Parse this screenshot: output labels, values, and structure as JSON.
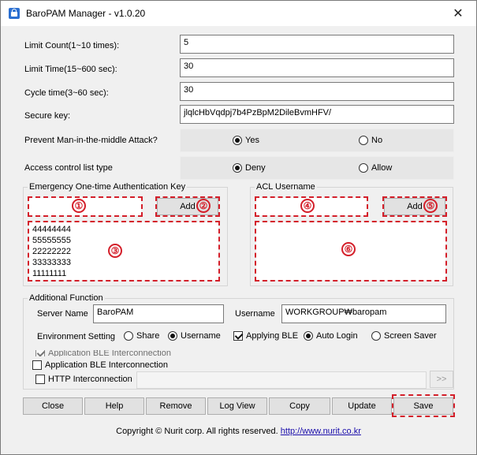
{
  "window": {
    "title": "BaroPAM Manager - v1.0.20",
    "close_glyph": "✕"
  },
  "fields": {
    "limit_count": {
      "label": "Limit Count(1~10 times):",
      "value": "5"
    },
    "limit_time": {
      "label": "Limit Time(15~600 sec):",
      "value": "30"
    },
    "cycle_time": {
      "label": "Cycle time(3~60 sec):",
      "value": "30"
    },
    "secure_key": {
      "label": "Secure key:",
      "value": "jlqlcHbVqdpj7b4PzBpM2DileBvmHFV/"
    }
  },
  "mitm": {
    "label": "Prevent Man-in-the-middle Attack?",
    "yes": "Yes",
    "no": "No",
    "selected": "Yes"
  },
  "acl_type": {
    "label": "Access control list type",
    "deny": "Deny",
    "allow": "Allow",
    "selected": "Deny"
  },
  "emergency": {
    "title": "Emergency One-time Authentication Key",
    "input_value": "",
    "add_label": "Add",
    "keys": [
      "44444444",
      "55555555",
      "22222222",
      "33333333",
      "11111111"
    ]
  },
  "acl": {
    "title": "ACL Username",
    "input_value": "",
    "add_label": "Add",
    "users": []
  },
  "markers": [
    "①",
    "②",
    "③",
    "④",
    "⑤",
    "⑥"
  ],
  "additional": {
    "title": "Additional Function",
    "server_name_label": "Server Name",
    "server_name_value": "BaroPAM",
    "username_label": "Username",
    "username_value": "WORKGROUP₩baropam",
    "env_label": "Environment Setting",
    "share": "Share",
    "username_opt": "Username",
    "env_selected": "Username",
    "applying_ble": "Applying BLE",
    "auto_login": "Auto Login",
    "screen_saver": "Screen Saver",
    "login_selected": "Auto Login",
    "ghost_text": "Application BLE Interconnection",
    "app_ble": "Application BLE Interconnection",
    "http": "HTTP Interconnection",
    "http_value": "",
    "go_label": ">>"
  },
  "buttons": {
    "close": "Close",
    "help": "Help",
    "remove": "Remove",
    "log_view": "Log View",
    "copy": "Copy",
    "update": "Update",
    "save": "Save"
  },
  "footer": {
    "copyright": "Copyright © Nurit corp. All rights reserved.",
    "link": "http://www.nurit.co.kr"
  },
  "colors": {
    "annotation": "#d41f2a",
    "link": "#1a0dab"
  }
}
